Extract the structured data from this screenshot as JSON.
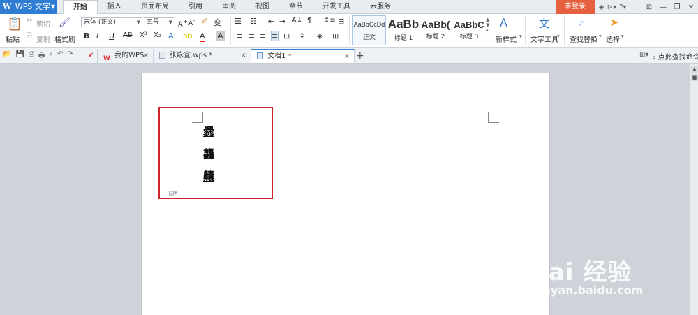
{
  "app": {
    "name": "WPS 文字",
    "logo": "W"
  },
  "menu": {
    "tabs": [
      "开始",
      "插入",
      "页面布局",
      "引用",
      "审阅",
      "视图",
      "章节",
      "开发工具",
      "云服务"
    ],
    "active": "开始",
    "login_label": "未登录"
  },
  "ribbon": {
    "paste_label": "粘贴",
    "cut_label": "剪切",
    "copy_label": "复制",
    "format_painter_label": "格式刷",
    "font_name": "宋体 (正文)",
    "font_size": "五号",
    "styles": [
      {
        "sample": "AaBbCcDd",
        "label": "正文"
      },
      {
        "sample": "AaBb",
        "label": "标题 1"
      },
      {
        "sample": "AaBb(",
        "label": "标题 2"
      },
      {
        "sample": "AaBbC",
        "label": "标题 3"
      }
    ],
    "new_style_label": "新样式",
    "text_tools_label": "文字工具",
    "find_replace_label": "查找替换",
    "select_label": "选择"
  },
  "tabs": {
    "items": [
      {
        "label": "我的WPS"
      },
      {
        "label": "张咏宣.wps *"
      },
      {
        "label": "文档1 *"
      }
    ],
    "active_index": 2,
    "search_command_label": "点此查找命令"
  },
  "document": {
    "characters": [
      "爨",
      "龘",
      "齉"
    ]
  },
  "watermark": {
    "main": "Bai 经验",
    "sub": "jingyan.baidu.com"
  },
  "colors": {
    "accent": "#2f7cd3",
    "login": "#e5603e",
    "highlight_box": "#c9252b"
  }
}
